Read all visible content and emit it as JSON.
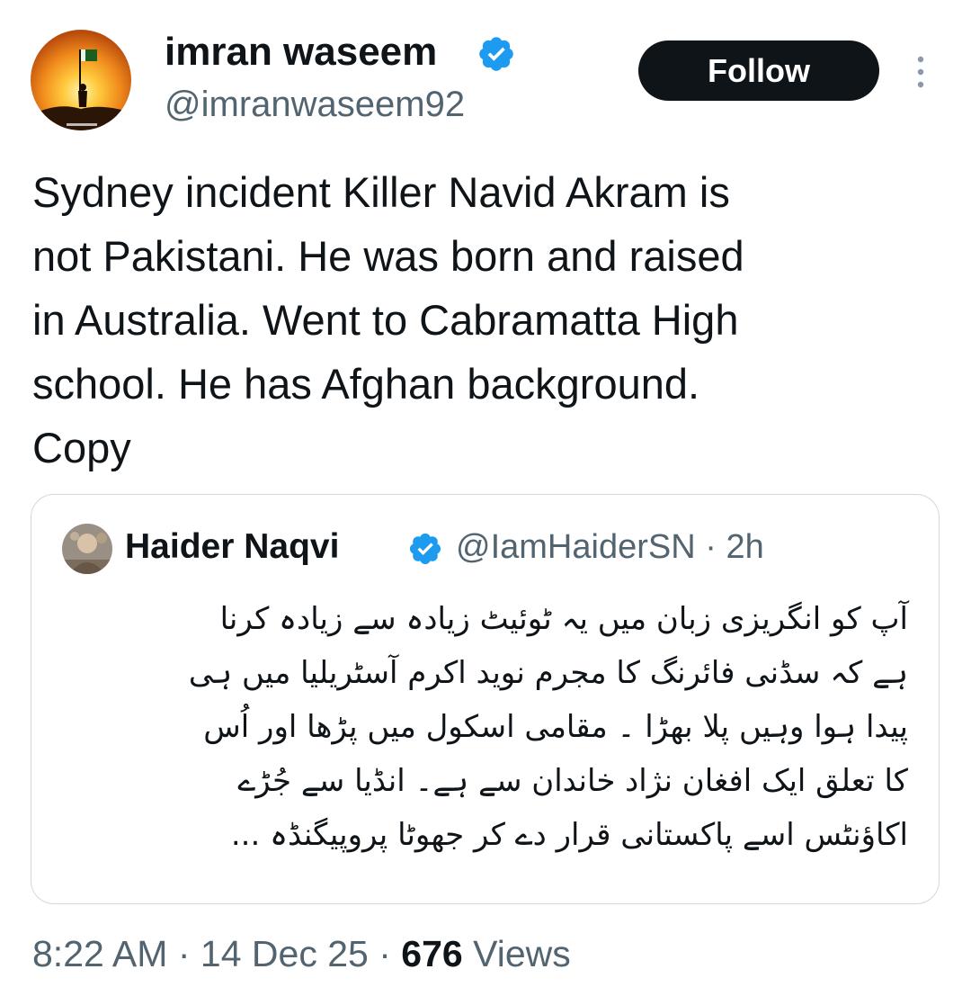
{
  "author": {
    "display_name": "imran waseem",
    "handle": "@imranwaseem92",
    "verified_icon": "verified-badge-icon",
    "avatar_icon": "sunset-flag-avatar"
  },
  "follow_button": {
    "label": "Follow"
  },
  "more_icon": "more-vertical-icon",
  "tweet": {
    "text": "Sydney incident Killer Navid Akram is\nnot Pakistani. He was born and raised\nin Australia. Went to Cabramatta High\nschool. He has Afghan background.\nCopy"
  },
  "quoted_tweet": {
    "display_name": "Haider Naqvi",
    "handle": "@IamHaiderSN",
    "separator": "·",
    "time": "2h",
    "text": "آپ کو انگریزی زبان میں یہ ٹوئیٹ زیادہ سے زیادہ کرنا\nہے کہ سڈنی فائرنگ کا مجرم نوید اکرم آسٹریلیا میں ہی\nپیدا ہوا وہیں پلا بھڑا ۔ مقامی اسکول میں پڑھا اور اُس\nکا تعلق ایک افغان نژاد خاندان سے ہے۔ انڈیا سے جُڑے\nاکاؤنٹس اسے پاکستانی قرار دے کر جھوٹا پروپیگنڈہ ..."
  },
  "footer": {
    "time": "8:22 AM",
    "separator": "·",
    "date": "14 Dec 25",
    "views_count": "676",
    "views_label": "Views"
  },
  "colors": {
    "text_primary": "#0f1419",
    "text_secondary": "#536471",
    "verified_blue": "#1d9bf0",
    "border": "#cfd9de",
    "button_bg": "#0f1419"
  }
}
